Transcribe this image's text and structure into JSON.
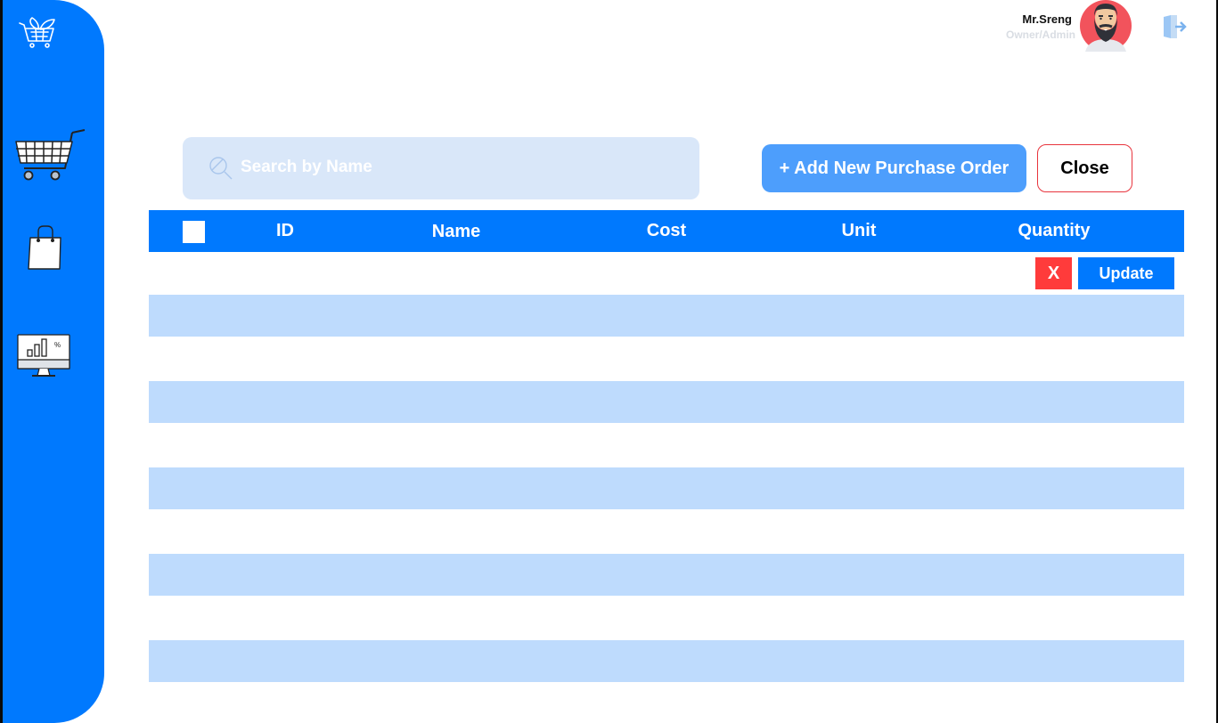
{
  "user": {
    "name": "Mr.Sreng",
    "role": "Owner/Admin"
  },
  "search": {
    "placeholder": "Search by Name"
  },
  "toolbar": {
    "add_label": "+ Add New Purchase Order",
    "close_label": "Close"
  },
  "table": {
    "columns": [
      "ID",
      "Name",
      "Cost",
      "Unit",
      "Quantity"
    ],
    "row_actions": {
      "delete_label": "X",
      "update_label": "Update"
    }
  },
  "sidebar": {
    "items": [
      {
        "icon": "logo-icon"
      },
      {
        "icon": "cart-icon"
      },
      {
        "icon": "shopping-bag-icon"
      },
      {
        "icon": "sales-report-monitor-icon"
      }
    ]
  },
  "colors": {
    "primary": "#0079fe",
    "button_light": "#4d9efc",
    "search_bg": "#d9e7f9",
    "row_stripe": "#bedbfd",
    "danger": "#ff3b3b",
    "close_border": "#e8343d"
  }
}
